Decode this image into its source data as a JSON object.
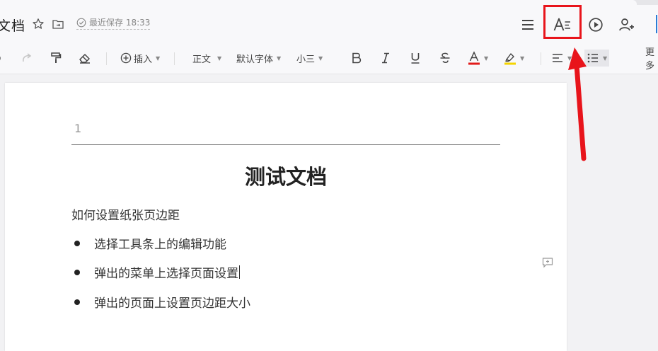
{
  "header": {
    "doc_title": "文档",
    "save_status": "最近保存 18:33"
  },
  "toolbar": {
    "insert_label": "插入",
    "style_label": "正文",
    "font_label": "默认字体",
    "size_label": "小三",
    "more_label": "更多"
  },
  "document": {
    "page_header_number": "1",
    "heading": "测试文档",
    "paragraph": "如何设置纸张页边距",
    "bullets": [
      "选择工具条上的编辑功能",
      "弹出的菜单上选择页面设置",
      "弹出的页面上设置页边距大小"
    ]
  },
  "colors": {
    "font_color_bar": "#e21b1b",
    "highlight_bar": "#f5d400",
    "annotation_red": "#e8141b",
    "accent_blue": "#2b7cd6"
  }
}
